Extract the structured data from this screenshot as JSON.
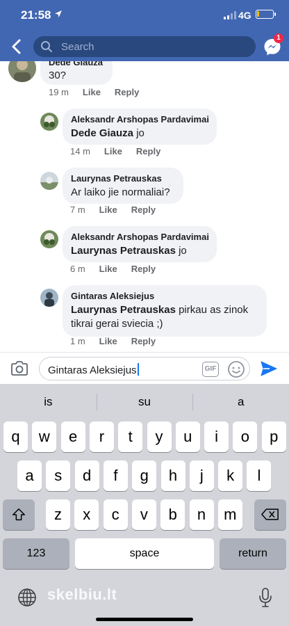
{
  "status": {
    "time": "21:58",
    "network": "4G",
    "battery_level": 0.15,
    "colors": {
      "battery": "#f5c400"
    }
  },
  "nav": {
    "search_placeholder": "Search",
    "messenger_badge": "1",
    "brand_color": "#4267b2"
  },
  "comments": [
    {
      "author": "Dede Giauza",
      "text": "30?",
      "time": "19 m",
      "like": "Like",
      "reply": "Reply"
    },
    {
      "author": "Aleksandr Arshopas Pardavimai",
      "mention": "Dede Giauza",
      "text": " jo",
      "time": "14 m",
      "like": "Like",
      "reply": "Reply"
    },
    {
      "author": "Laurynas Petrauskas",
      "text": "Ar laiko jie normaliai?",
      "time": "7 m",
      "like": "Like",
      "reply": "Reply"
    },
    {
      "author": "Aleksandr Arshopas Pardavimai",
      "mention": "Laurynas Petrauskas",
      "text": " jo",
      "time": "6 m",
      "like": "Like",
      "reply": "Reply"
    },
    {
      "author": "Gintaras Aleksiejus",
      "mention": "Laurynas Petrauskas",
      "text": " pirkau as zinok tikrai gerai sviecia ;)",
      "time": "1 m",
      "like": "Like",
      "reply": "Reply"
    }
  ],
  "composer": {
    "value": "Gintaras Aleksiejus",
    "gif_label": "GIF"
  },
  "keyboard": {
    "suggestions": [
      "is",
      "su",
      "a"
    ],
    "row1": [
      "q",
      "w",
      "e",
      "r",
      "t",
      "y",
      "u",
      "i",
      "o",
      "p"
    ],
    "row2": [
      "a",
      "s",
      "d",
      "f",
      "g",
      "h",
      "j",
      "k",
      "l"
    ],
    "row3": [
      "z",
      "x",
      "c",
      "v",
      "b",
      "n",
      "m"
    ],
    "numbers_key": "123",
    "space_key": "space",
    "return_key": "return"
  },
  "watermark": "skelbiu.lt"
}
